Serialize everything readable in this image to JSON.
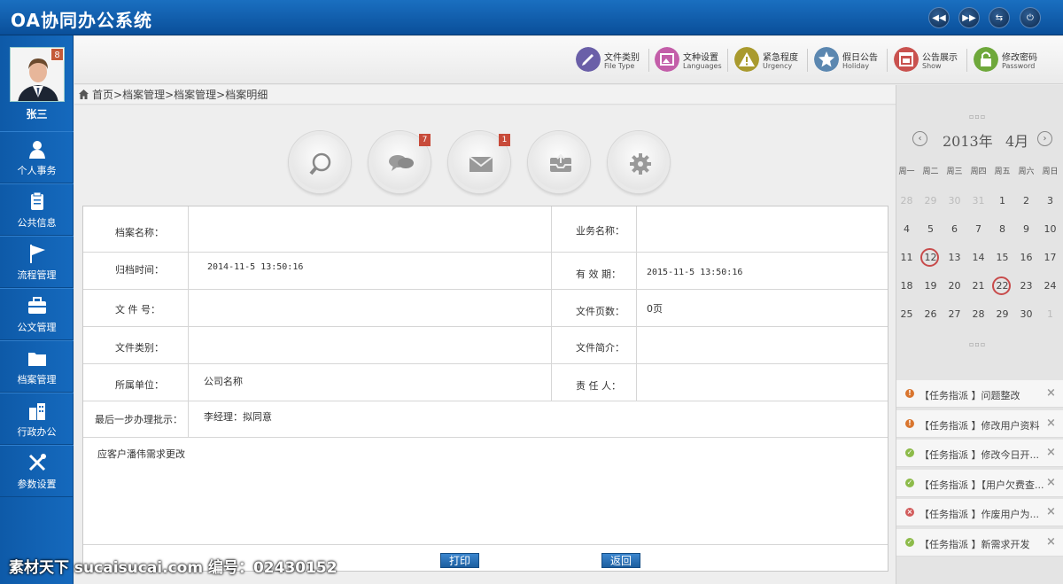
{
  "app": {
    "title": "OA协同办公系统"
  },
  "header": {
    "controls": [
      {
        "name": "rewind-icon",
        "glyph": "◀◀"
      },
      {
        "name": "forward-icon",
        "glyph": "▶▶"
      },
      {
        "name": "swap-icon",
        "glyph": "⇆"
      },
      {
        "name": "power-icon",
        "glyph": "⏻"
      }
    ]
  },
  "user": {
    "name": "张三",
    "badge": "8"
  },
  "nav": [
    {
      "label": "个人事务",
      "icon": "person-icon"
    },
    {
      "label": "公共信息",
      "icon": "clipboard-icon"
    },
    {
      "label": "流程管理",
      "icon": "flag-icon"
    },
    {
      "label": "公文管理",
      "icon": "briefcase-icon"
    },
    {
      "label": "档案管理",
      "icon": "folder-icon"
    },
    {
      "label": "行政办公",
      "icon": "building-icon"
    },
    {
      "label": "参数设置",
      "icon": "tools-icon"
    }
  ],
  "toolbar": [
    {
      "cn": "文件类别",
      "en": "File Type",
      "color": "#6a5fa8",
      "icon": "tag-icon"
    },
    {
      "cn": "文种设置",
      "en": "Languages",
      "color": "#c35ea9",
      "icon": "image-icon"
    },
    {
      "cn": "紧急程度",
      "en": "Urgency",
      "color": "#a99a2e",
      "icon": "warning-icon"
    },
    {
      "cn": "假日公告",
      "en": "Holiday",
      "color": "#5b87b0",
      "icon": "star-icon"
    },
    {
      "cn": "公告展示",
      "en": "Show",
      "color": "#c9524f",
      "icon": "calendar-icon"
    },
    {
      "cn": "修改密码",
      "en": "Password",
      "color": "#6ea83b",
      "icon": "lock-icon"
    }
  ],
  "breadcrumb": [
    "首页",
    "档案管理",
    "档案管理",
    "档案明细"
  ],
  "quick_actions": [
    {
      "name": "search",
      "badge": ""
    },
    {
      "name": "message",
      "badge": "7"
    },
    {
      "name": "mail",
      "badge": "1"
    },
    {
      "name": "inbox",
      "badge": ""
    },
    {
      "name": "settings",
      "badge": ""
    }
  ],
  "form": {
    "archive_name_label": "档案名称：",
    "archive_name_value": "",
    "business_name_label": "业务名称：",
    "business_name_value": "",
    "archive_time_label": "归档时间：",
    "archive_time_value": "2014-11-5 13:50:16",
    "valid_period_label": "有 效 期：",
    "valid_period_value": "2015-11-5 13:50:16",
    "doc_no_label": "文 件 号：",
    "doc_no_value": "",
    "pages_label": "文件页数：",
    "pages_value": "0页",
    "doc_type_label": "文件类别：",
    "doc_type_value": "",
    "summary_label": "文件简介：",
    "summary_value": "",
    "unit_label": "所属单位：",
    "unit_value": "公司名称",
    "owner_label": "责 任 人：",
    "owner_value": "",
    "last_step_label": "最后一步办理批示：",
    "last_step_value": "李经理：拟同意",
    "remarks": "应客户潘伟需求更改",
    "print_label": "打印",
    "back_label": "返回"
  },
  "calendar": {
    "year": "2013年",
    "month": "4月",
    "weekdays": [
      "周一",
      "周二",
      "周三",
      "周四",
      "周五",
      "周六",
      "周日"
    ],
    "weeks": [
      [
        {
          "d": "28",
          "m": true
        },
        {
          "d": "29",
          "m": true
        },
        {
          "d": "30",
          "m": true
        },
        {
          "d": "31",
          "m": true
        },
        {
          "d": "1"
        },
        {
          "d": "2"
        },
        {
          "d": "3"
        }
      ],
      [
        {
          "d": "4"
        },
        {
          "d": "5"
        },
        {
          "d": "6"
        },
        {
          "d": "7"
        },
        {
          "d": "8"
        },
        {
          "d": "9"
        },
        {
          "d": "10"
        }
      ],
      [
        {
          "d": "11"
        },
        {
          "d": "12",
          "c": true
        },
        {
          "d": "13"
        },
        {
          "d": "14"
        },
        {
          "d": "15"
        },
        {
          "d": "16"
        },
        {
          "d": "17"
        }
      ],
      [
        {
          "d": "18"
        },
        {
          "d": "19"
        },
        {
          "d": "20"
        },
        {
          "d": "21"
        },
        {
          "d": "22",
          "c": true
        },
        {
          "d": "23"
        },
        {
          "d": "24"
        }
      ],
      [
        {
          "d": "25"
        },
        {
          "d": "26"
        },
        {
          "d": "27"
        },
        {
          "d": "28"
        },
        {
          "d": "29"
        },
        {
          "d": "30"
        },
        {
          "d": "1",
          "m": true
        }
      ]
    ]
  },
  "tasks": [
    {
      "text": "【任务指派 】问题整改",
      "status": "warn",
      "color": "#d9752e"
    },
    {
      "text": "【任务指派 】修改用户资料",
      "status": "warn",
      "color": "#d9752e"
    },
    {
      "text": "【任务指派 】修改今日开...",
      "status": "ok",
      "color": "#8dbb4a"
    },
    {
      "text": "【任务指派 】【用户欠费查...",
      "status": "ok",
      "color": "#8dbb4a"
    },
    {
      "text": "【任务指派 】作废用户为...",
      "status": "error",
      "color": "#d25c5c"
    },
    {
      "text": "【任务指派 】新需求开发",
      "status": "ok",
      "color": "#8dbb4a"
    }
  ],
  "watermark": "素材天下 sucaisucai.com  编号：02430152"
}
